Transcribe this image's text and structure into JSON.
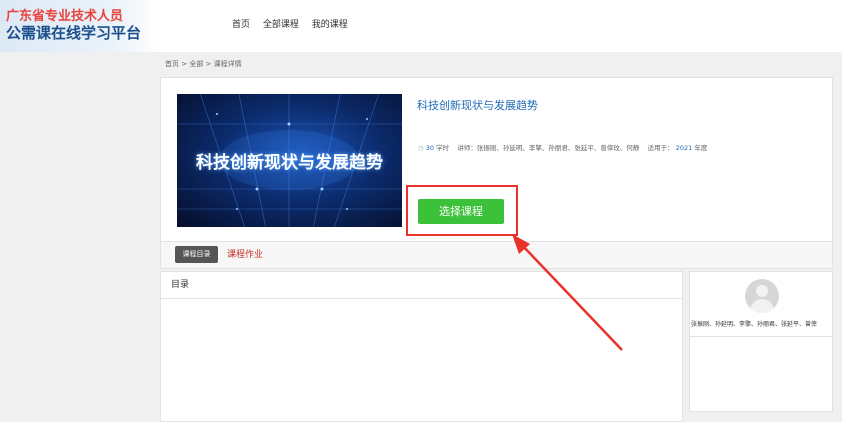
{
  "header": {
    "logo_line1": "广东省专业技术人员",
    "logo_line2": "公需课在线学习平台",
    "nav": [
      "首页",
      "全部课程",
      "我的课程"
    ]
  },
  "breadcrumb": "首页 > 全部 > 课程详情",
  "course": {
    "thumbnail_text": "科技创新现状与发展趋势",
    "title": "科技创新现状与发展趋势",
    "hours_value": "30",
    "hours_unit": "学时",
    "lecturers_label": "讲师：",
    "lecturers": "张振刚、孙延明、李擎、孙丽君、张延平、曾倖玟、何静",
    "applicable_label": "适用于：",
    "applicable_year": "2021",
    "applicable_unit": "年度",
    "select_button": "选择课程"
  },
  "tabs": {
    "active": "课程目录",
    "inactive": "课程作业"
  },
  "catalog": {
    "heading": "目录"
  },
  "teacher_panel": {
    "names": "张振刚、孙延明、李擎、孙丽君、张延平、曾倖"
  },
  "colors": {
    "accent_blue": "#1e6bb8",
    "button_green": "#3cc23a",
    "highlight_red": "#e8322a"
  }
}
